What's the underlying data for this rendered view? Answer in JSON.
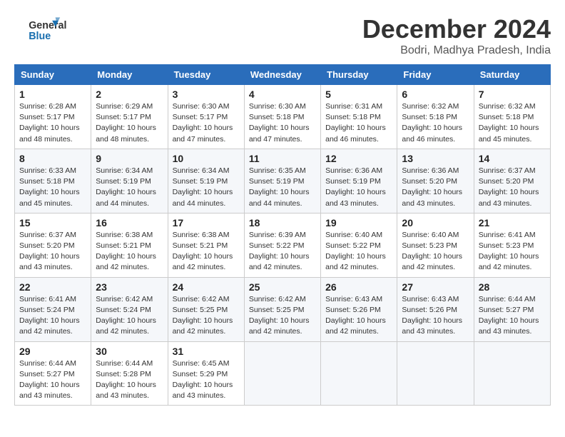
{
  "logo": {
    "line1": "General",
    "line2": "Blue"
  },
  "title": "December 2024",
  "subtitle": "Bodri, Madhya Pradesh, India",
  "headers": [
    "Sunday",
    "Monday",
    "Tuesday",
    "Wednesday",
    "Thursday",
    "Friday",
    "Saturday"
  ],
  "weeks": [
    [
      {
        "day": "1",
        "info": "Sunrise: 6:28 AM\nSunset: 5:17 PM\nDaylight: 10 hours\nand 48 minutes."
      },
      {
        "day": "2",
        "info": "Sunrise: 6:29 AM\nSunset: 5:17 PM\nDaylight: 10 hours\nand 48 minutes."
      },
      {
        "day": "3",
        "info": "Sunrise: 6:30 AM\nSunset: 5:17 PM\nDaylight: 10 hours\nand 47 minutes."
      },
      {
        "day": "4",
        "info": "Sunrise: 6:30 AM\nSunset: 5:18 PM\nDaylight: 10 hours\nand 47 minutes."
      },
      {
        "day": "5",
        "info": "Sunrise: 6:31 AM\nSunset: 5:18 PM\nDaylight: 10 hours\nand 46 minutes."
      },
      {
        "day": "6",
        "info": "Sunrise: 6:32 AM\nSunset: 5:18 PM\nDaylight: 10 hours\nand 46 minutes."
      },
      {
        "day": "7",
        "info": "Sunrise: 6:32 AM\nSunset: 5:18 PM\nDaylight: 10 hours\nand 45 minutes."
      }
    ],
    [
      {
        "day": "8",
        "info": "Sunrise: 6:33 AM\nSunset: 5:18 PM\nDaylight: 10 hours\nand 45 minutes."
      },
      {
        "day": "9",
        "info": "Sunrise: 6:34 AM\nSunset: 5:19 PM\nDaylight: 10 hours\nand 44 minutes."
      },
      {
        "day": "10",
        "info": "Sunrise: 6:34 AM\nSunset: 5:19 PM\nDaylight: 10 hours\nand 44 minutes."
      },
      {
        "day": "11",
        "info": "Sunrise: 6:35 AM\nSunset: 5:19 PM\nDaylight: 10 hours\nand 44 minutes."
      },
      {
        "day": "12",
        "info": "Sunrise: 6:36 AM\nSunset: 5:19 PM\nDaylight: 10 hours\nand 43 minutes."
      },
      {
        "day": "13",
        "info": "Sunrise: 6:36 AM\nSunset: 5:20 PM\nDaylight: 10 hours\nand 43 minutes."
      },
      {
        "day": "14",
        "info": "Sunrise: 6:37 AM\nSunset: 5:20 PM\nDaylight: 10 hours\nand 43 minutes."
      }
    ],
    [
      {
        "day": "15",
        "info": "Sunrise: 6:37 AM\nSunset: 5:20 PM\nDaylight: 10 hours\nand 43 minutes."
      },
      {
        "day": "16",
        "info": "Sunrise: 6:38 AM\nSunset: 5:21 PM\nDaylight: 10 hours\nand 42 minutes."
      },
      {
        "day": "17",
        "info": "Sunrise: 6:38 AM\nSunset: 5:21 PM\nDaylight: 10 hours\nand 42 minutes."
      },
      {
        "day": "18",
        "info": "Sunrise: 6:39 AM\nSunset: 5:22 PM\nDaylight: 10 hours\nand 42 minutes."
      },
      {
        "day": "19",
        "info": "Sunrise: 6:40 AM\nSunset: 5:22 PM\nDaylight: 10 hours\nand 42 minutes."
      },
      {
        "day": "20",
        "info": "Sunrise: 6:40 AM\nSunset: 5:23 PM\nDaylight: 10 hours\nand 42 minutes."
      },
      {
        "day": "21",
        "info": "Sunrise: 6:41 AM\nSunset: 5:23 PM\nDaylight: 10 hours\nand 42 minutes."
      }
    ],
    [
      {
        "day": "22",
        "info": "Sunrise: 6:41 AM\nSunset: 5:24 PM\nDaylight: 10 hours\nand 42 minutes."
      },
      {
        "day": "23",
        "info": "Sunrise: 6:42 AM\nSunset: 5:24 PM\nDaylight: 10 hours\nand 42 minutes."
      },
      {
        "day": "24",
        "info": "Sunrise: 6:42 AM\nSunset: 5:25 PM\nDaylight: 10 hours\nand 42 minutes."
      },
      {
        "day": "25",
        "info": "Sunrise: 6:42 AM\nSunset: 5:25 PM\nDaylight: 10 hours\nand 42 minutes."
      },
      {
        "day": "26",
        "info": "Sunrise: 6:43 AM\nSunset: 5:26 PM\nDaylight: 10 hours\nand 42 minutes."
      },
      {
        "day": "27",
        "info": "Sunrise: 6:43 AM\nSunset: 5:26 PM\nDaylight: 10 hours\nand 43 minutes."
      },
      {
        "day": "28",
        "info": "Sunrise: 6:44 AM\nSunset: 5:27 PM\nDaylight: 10 hours\nand 43 minutes."
      }
    ],
    [
      {
        "day": "29",
        "info": "Sunrise: 6:44 AM\nSunset: 5:27 PM\nDaylight: 10 hours\nand 43 minutes."
      },
      {
        "day": "30",
        "info": "Sunrise: 6:44 AM\nSunset: 5:28 PM\nDaylight: 10 hours\nand 43 minutes."
      },
      {
        "day": "31",
        "info": "Sunrise: 6:45 AM\nSunset: 5:29 PM\nDaylight: 10 hours\nand 43 minutes."
      },
      {
        "day": "",
        "info": ""
      },
      {
        "day": "",
        "info": ""
      },
      {
        "day": "",
        "info": ""
      },
      {
        "day": "",
        "info": ""
      }
    ]
  ]
}
